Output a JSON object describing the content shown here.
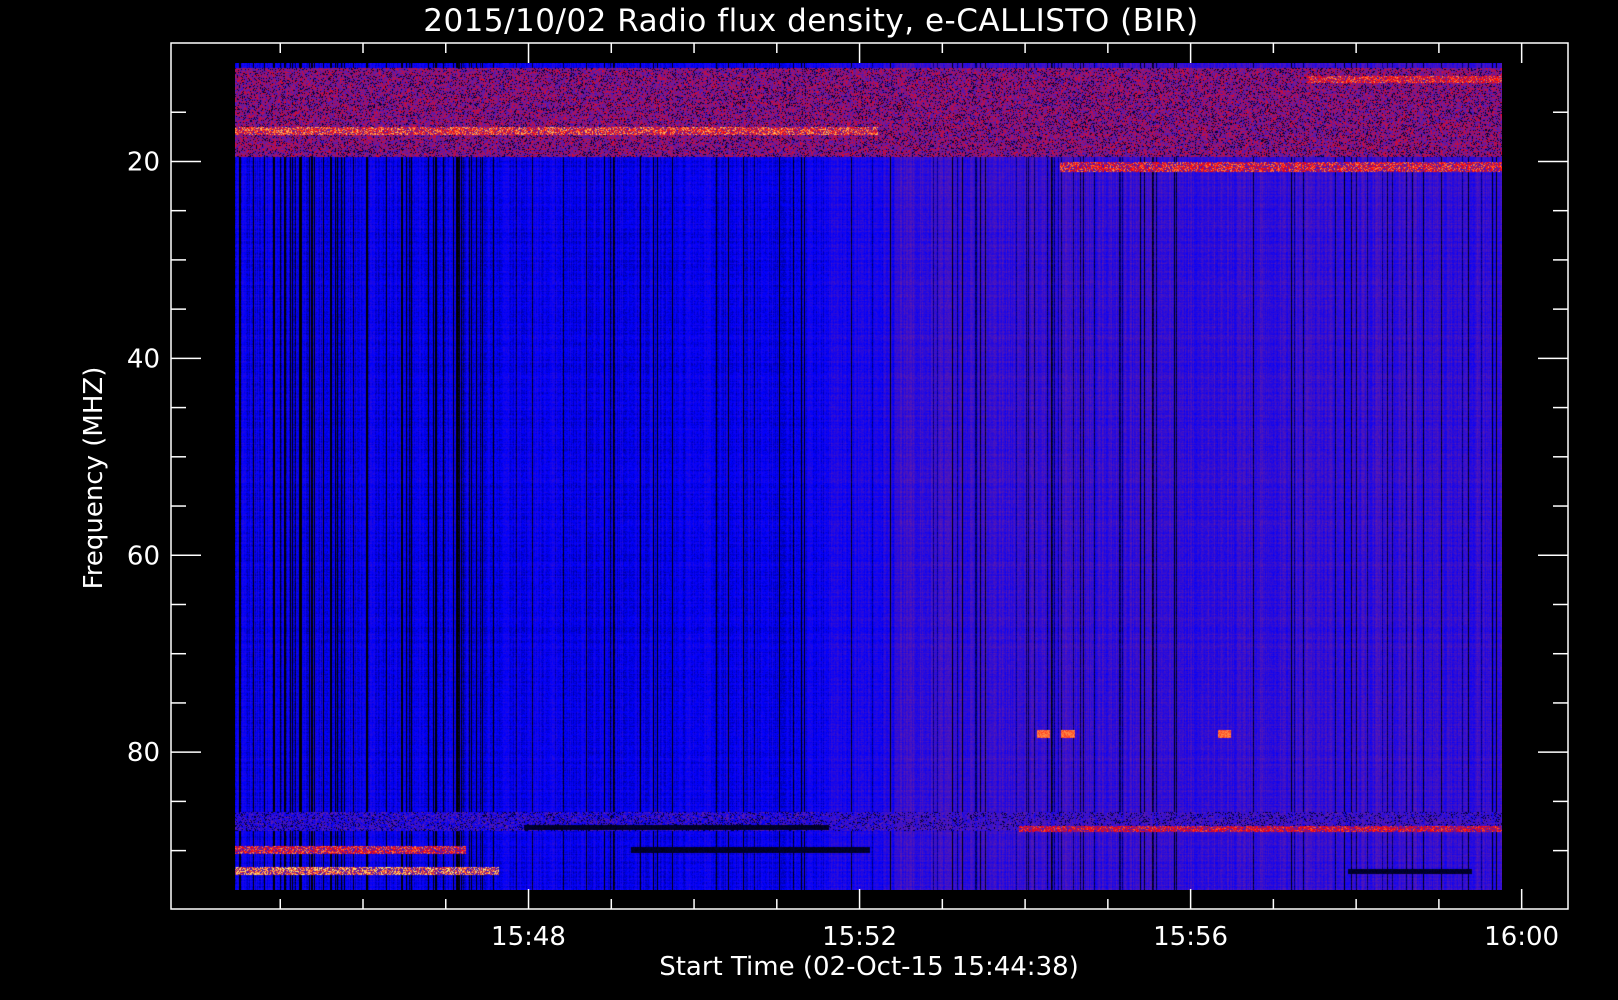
{
  "chart_data": {
    "type": "heatmap",
    "title": "2015/10/02  Radio flux density, e-CALLISTO (BIR)",
    "xlabel": "Start Time (02-Oct-15 15:44:38)",
    "ylabel": "Frequency (MHZ)",
    "x_start_minutes": 0,
    "x_end_minutes": 15.37,
    "x_axis_min_minutes": -0.95,
    "x_axis_max_minutes": 15.93,
    "ylim": [
      10,
      94
    ],
    "y_inverted": true,
    "x_ticks": [
      {
        "minutes": 3.37,
        "label": "15:48"
      },
      {
        "minutes": 7.37,
        "label": "15:52"
      },
      {
        "minutes": 11.37,
        "label": "15:56"
      },
      {
        "minutes": 15.37,
        "label": "16:00"
      }
    ],
    "y_ticks": [
      {
        "value": 20,
        "label": "20"
      },
      {
        "value": 40,
        "label": "40"
      },
      {
        "value": 60,
        "label": "60"
      },
      {
        "value": 80,
        "label": "80"
      }
    ],
    "colormap": [
      "#000000",
      "#0000ff",
      "#6a1ea0",
      "#ff0000",
      "#ffff80"
    ],
    "colors": {
      "background": "#000000",
      "axis": "#ffffff",
      "low_signal": "#1a1af0",
      "high_signal": "#ff2000"
    },
    "emission_features": [
      {
        "kind": "band",
        "f_start": 10.5,
        "f_end": 19.5,
        "t_start": 0,
        "t_end": 15.37,
        "intensity": 0.55
      },
      {
        "kind": "band",
        "f_start": 16.5,
        "f_end": 17.3,
        "t_start": 0,
        "t_end": 7.8,
        "intensity": 0.85
      },
      {
        "kind": "band",
        "f_start": 20.0,
        "f_end": 21.0,
        "t_start": 10.0,
        "t_end": 15.37,
        "intensity": 0.8
      },
      {
        "kind": "band",
        "f_start": 11.3,
        "f_end": 12.0,
        "t_start": 13.0,
        "t_end": 15.37,
        "intensity": 0.8
      },
      {
        "kind": "band",
        "f_start": 86.0,
        "f_end": 88.0,
        "t_start": 0,
        "t_end": 15.37,
        "intensity": 0.35
      },
      {
        "kind": "band",
        "f_start": 87.4,
        "f_end": 88.1,
        "t_start": 9.5,
        "t_end": 15.37,
        "intensity": 0.75
      },
      {
        "kind": "band",
        "f_start": 89.5,
        "f_end": 90.3,
        "t_start": 0,
        "t_end": 2.8,
        "intensity": 0.8
      },
      {
        "kind": "band",
        "f_start": 91.6,
        "f_end": 92.4,
        "t_start": 0,
        "t_end": 3.2,
        "intensity": 0.9
      },
      {
        "kind": "dark_band",
        "f_start": 87.3,
        "f_end": 87.9,
        "t_start": 3.5,
        "t_end": 7.2
      },
      {
        "kind": "dark_band",
        "f_start": 89.6,
        "f_end": 90.2,
        "t_start": 4.8,
        "t_end": 7.7
      },
      {
        "kind": "dark_band",
        "f_start": 91.8,
        "f_end": 92.3,
        "t_start": 13.5,
        "t_end": 15.0
      },
      {
        "kind": "spot",
        "f": 78.1,
        "t": 9.8,
        "intensity": 0.85
      },
      {
        "kind": "spot",
        "f": 78.1,
        "t": 10.1,
        "intensity": 0.85
      },
      {
        "kind": "spot",
        "f": 78.1,
        "t": 12.0,
        "intensity": 0.85
      }
    ]
  }
}
